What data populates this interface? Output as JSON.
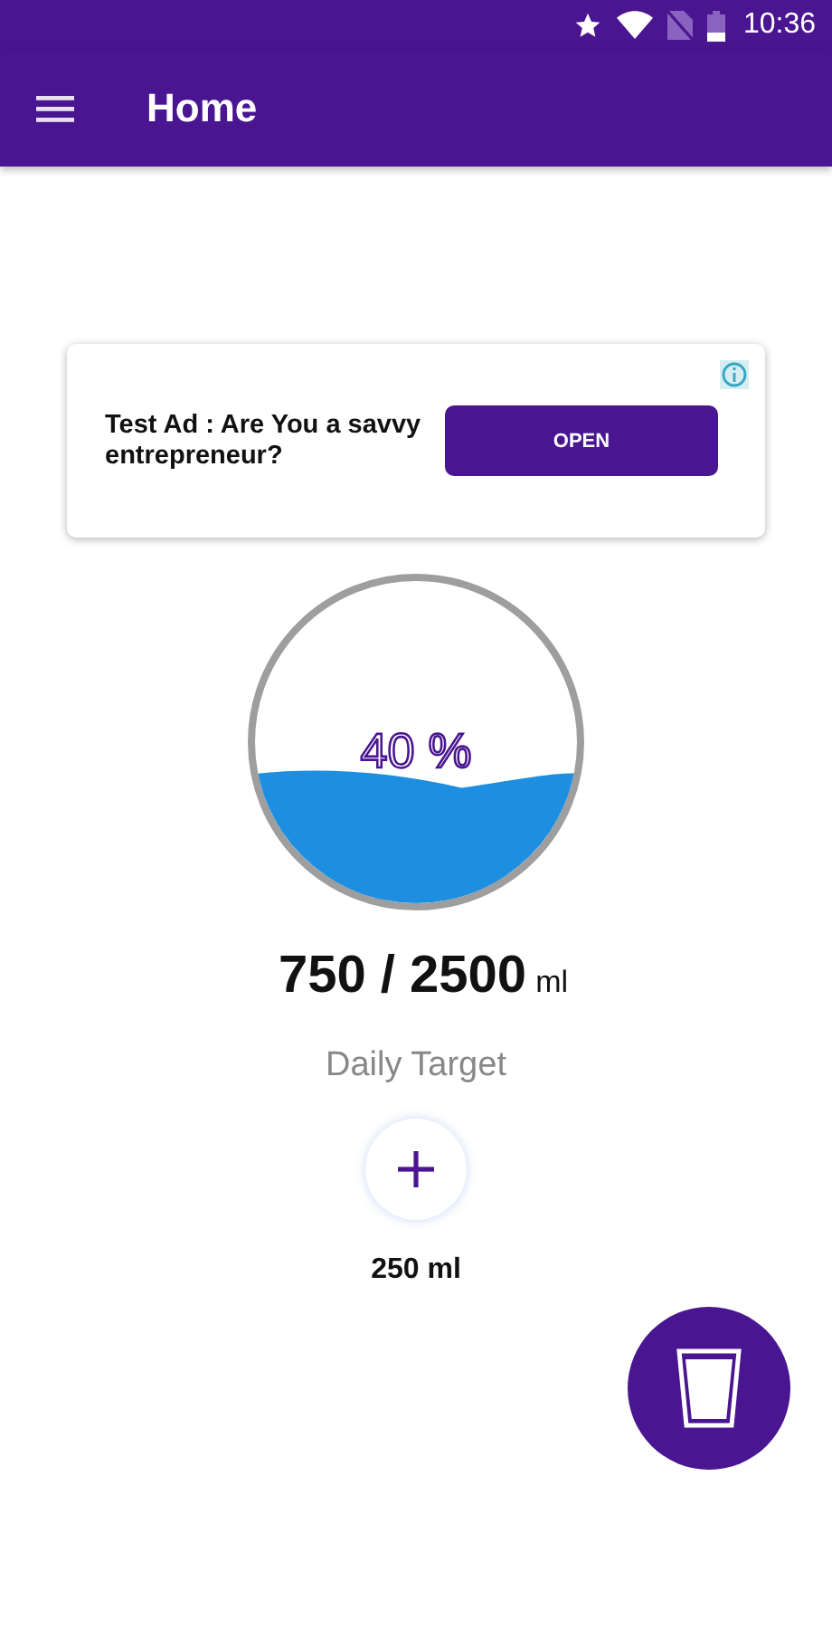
{
  "status_bar": {
    "time": "10:36"
  },
  "app_bar": {
    "title": "Home"
  },
  "ad": {
    "text": "Test Ad : Are You a savvy entrepreneur?",
    "button": "OPEN"
  },
  "gauge": {
    "percent": "40 %"
  },
  "intake": {
    "amount": "750 / 2500",
    "unit": "ml",
    "caption": "Daily Target"
  },
  "add": {
    "amount": "250 ml"
  }
}
